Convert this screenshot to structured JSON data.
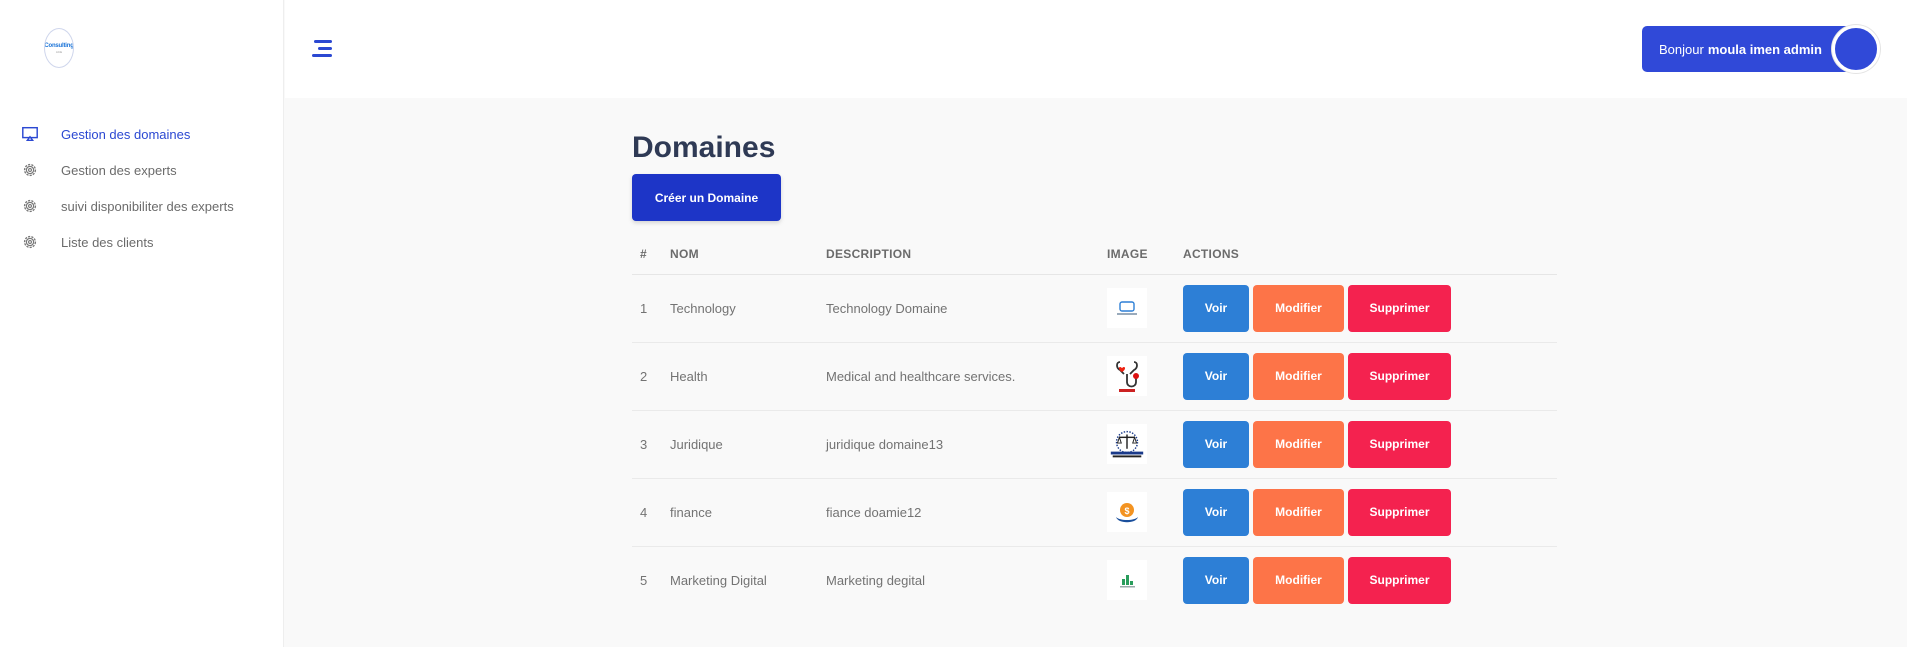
{
  "logo": {
    "text": "Consulting",
    "sub": "ACE"
  },
  "sidebar": {
    "items": [
      {
        "label": "Gestion des domaines",
        "icon": "monitor-icon",
        "active": true
      },
      {
        "label": "Gestion des experts",
        "icon": "gear-icon",
        "active": false
      },
      {
        "label": "suivi disponibiliter des experts",
        "icon": "gear-icon",
        "active": false
      },
      {
        "label": "Liste des clients",
        "icon": "gear-icon",
        "active": false
      }
    ]
  },
  "header": {
    "greeting": "Bonjour",
    "username": "moula imen admin"
  },
  "main": {
    "title": "Domaines",
    "create_label": "Créer un Domaine",
    "columns": [
      "#",
      "NOM",
      "DESCRIPTION",
      "IMAGE",
      "ACTIONS"
    ],
    "rows": [
      {
        "num": "1",
        "nom": "Technology",
        "description": "Technology Domaine",
        "image": "technology-image"
      },
      {
        "num": "2",
        "nom": "Health",
        "description": "Medical and healthcare services.",
        "image": "medical-image"
      },
      {
        "num": "3",
        "nom": "Juridique",
        "description": "juridique domaine13",
        "image": "justice-image"
      },
      {
        "num": "4",
        "nom": "finance",
        "description": "fiance doamie12",
        "image": "finance-image"
      },
      {
        "num": "5",
        "nom": "Marketing Digital",
        "description": "Marketing degital",
        "image": "marketing-image"
      }
    ],
    "actions": {
      "view": "Voir",
      "edit": "Modifier",
      "delete": "Supprimer"
    }
  },
  "colors": {
    "primary": "#2b48d2",
    "view": "#2d7fd6",
    "edit": "#fd7448",
    "delete": "#f4224f",
    "create": "#1d35c7"
  }
}
